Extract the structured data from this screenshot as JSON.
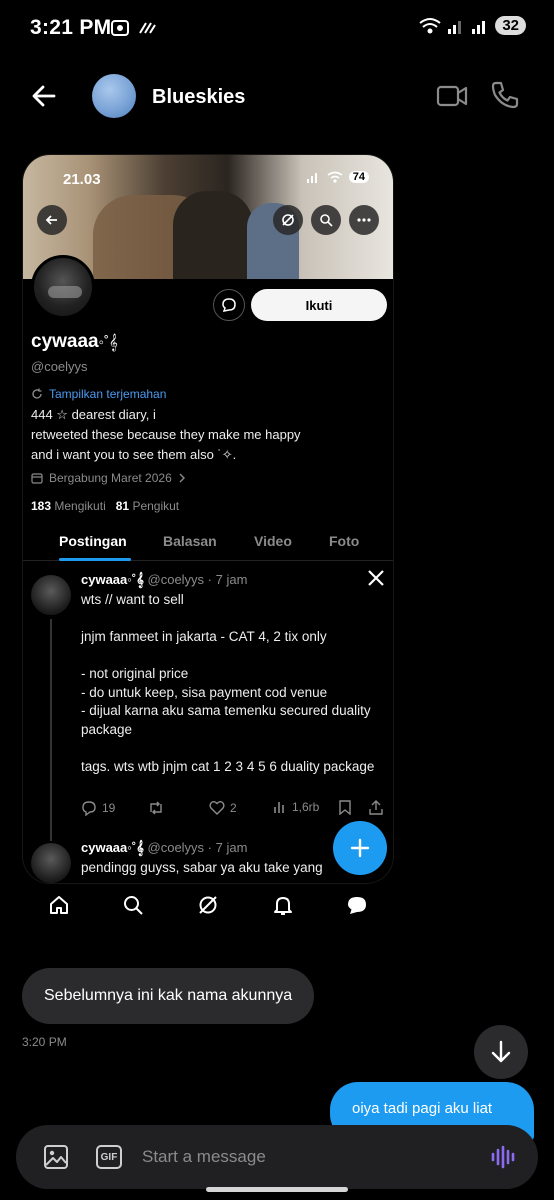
{
  "status_bar": {
    "time": "3:21 PM",
    "battery": "32"
  },
  "header": {
    "name": "Blueskies"
  },
  "shared_card": {
    "banner": {
      "time": "21.03",
      "battery": "74"
    },
    "follow_label": "Ikuti",
    "display_name": "cywaaa",
    "display_name_symbols": "◦˚𝄞",
    "handle": "@coelyys",
    "translate_label": "Tampilkan terjemahan",
    "bio_lines": [
      "444 ☆ dearest diary, i",
      "retweeted these because they make me happy",
      "and i want you to see them also ˙✧."
    ],
    "joined": "Bergabung Maret 2026",
    "following_count": "183",
    "following_label": "Mengikuti",
    "followers_count": "81",
    "followers_label": "Pengikut",
    "tabs": [
      "Postingan",
      "Balasan",
      "Video",
      "Foto"
    ],
    "posts": [
      {
        "name": "cywaaa◦˚𝄞",
        "meta": "@coelyys · 7 jam",
        "body": "wts // want to sell\n\njnjm fanmeet in jakarta - CAT 4, 2 tix only\n\n- not original price\n- do untuk keep, sisa payment cod venue\n- dijual karna aku sama temenku secured duality package\n\ntags. wts wtb jnjm cat 1 2 3 4 5 6 duality package",
        "replies": "19",
        "likes": "2",
        "views": "1,6rb"
      },
      {
        "name": "cywaaa◦˚𝄞",
        "meta": "@coelyys · 7 jam",
        "body": "pendingg guyss, sabar ya aku take yang"
      }
    ]
  },
  "chat": {
    "incoming_text": "Sebelumnya ini kak nama akunnya",
    "incoming_time": "3:20 PM",
    "outgoing_text": "oiya tadi pagi aku liat"
  },
  "composer": {
    "gif_label": "GIF",
    "placeholder": "Start a message"
  },
  "colors": {
    "accent": "#1d9bf0",
    "bubble_in": "#2b2b2e",
    "background": "#000000"
  }
}
